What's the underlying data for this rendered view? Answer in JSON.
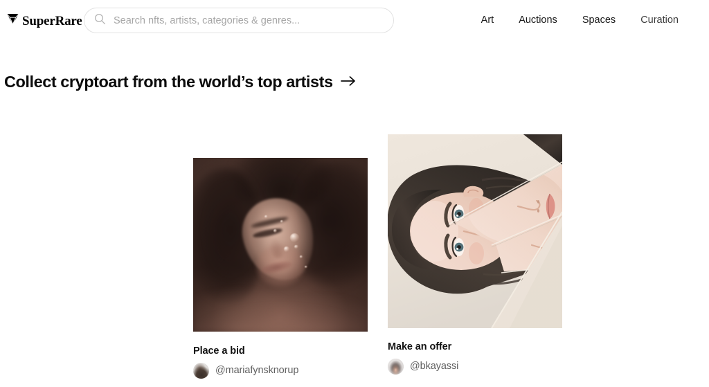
{
  "site": {
    "brand_name": "SuperRare",
    "logo_icon": "diamond-gem-icon"
  },
  "search": {
    "icon": "search-icon",
    "placeholder": "Search nfts, artists, categories & genres...",
    "value": ""
  },
  "nav": {
    "items": [
      {
        "label": "Art"
      },
      {
        "label": "Auctions"
      },
      {
        "label": "Spaces"
      },
      {
        "label": "Curation"
      }
    ]
  },
  "hero": {
    "title": "Collect cryptoart from the world’s top artists",
    "arrow_icon": "arrow-right-icon"
  },
  "cards": [
    {
      "action_label": "Place a bid",
      "artist_handle": "@mariafynsknorup",
      "artwork_alt": "dark moody portrait of a face submerged in water with droplets",
      "avatar_icon": "artist-avatar"
    },
    {
      "action_label": "Make an offer",
      "artist_handle": "@bkayassi",
      "artwork_alt": "rotated portrait of a woman with long dark hair, face fragmented into overlapping geometric panels on a beige background",
      "avatar_icon": "artist-avatar"
    }
  ],
  "colors": {
    "page_background": "#ffffff",
    "text_primary": "#111111",
    "text_muted": "#5f5f5f",
    "placeholder": "#a6a6a6",
    "search_border": "#e2e2e2",
    "artwork_1_base": "#3c2a23",
    "artwork_2_base": "#ece4da"
  }
}
